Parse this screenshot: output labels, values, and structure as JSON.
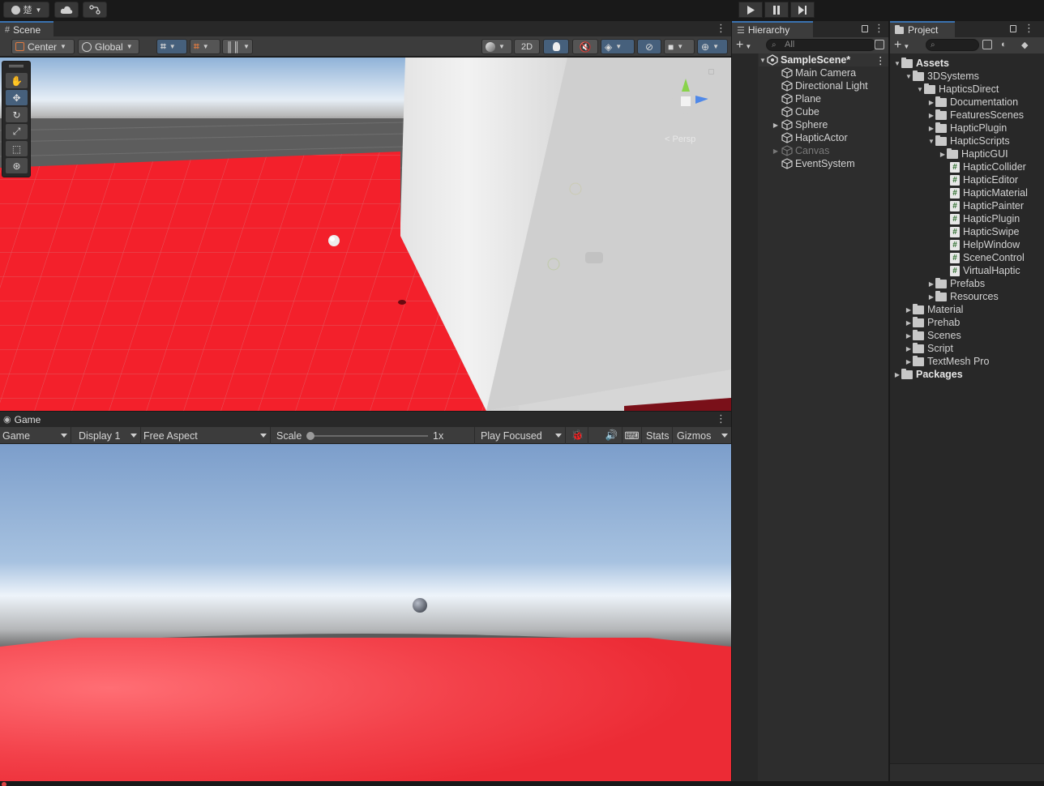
{
  "topbar": {
    "account_label": "楚",
    "play_controls": [
      "play",
      "pause",
      "step"
    ]
  },
  "scene": {
    "tab_label": "Scene",
    "pivot_label": "Center",
    "space_label": "Global",
    "mode_2d_label": "2D",
    "gizmo_axis_y": "y",
    "gizmo_axis_z": "z",
    "gizmo_persp_label": "Persp"
  },
  "game": {
    "tab_label": "Game",
    "view_select": "Game",
    "display_select": "Display 1",
    "aspect_select": "Free Aspect",
    "scale_label": "Scale",
    "scale_value": "1x",
    "play_mode_select": "Play Focused",
    "stats_label": "Stats",
    "gizmos_label": "Gizmos"
  },
  "hierarchy": {
    "tab_label": "Hierarchy",
    "search_placeholder": "All",
    "scene_name": "SampleScene*",
    "items": [
      {
        "label": "Main Camera"
      },
      {
        "label": "Directional Light"
      },
      {
        "label": "Plane"
      },
      {
        "label": "Cube"
      },
      {
        "label": "Sphere"
      },
      {
        "label": "HapticActor"
      },
      {
        "label": "Canvas"
      },
      {
        "label": "EventSystem"
      }
    ]
  },
  "project": {
    "tab_label": "Project",
    "tree": [
      {
        "label": "Assets"
      },
      {
        "label": "3DSystems"
      },
      {
        "label": "HapticsDirect"
      },
      {
        "label": "Documentation"
      },
      {
        "label": "FeaturesScenes"
      },
      {
        "label": "HapticPlugin"
      },
      {
        "label": "HapticScripts"
      },
      {
        "label": "HapticGUI"
      },
      {
        "label": "HapticCollider"
      },
      {
        "label": "HapticEditor"
      },
      {
        "label": "HapticMaterial"
      },
      {
        "label": "HapticPainter"
      },
      {
        "label": "HapticPlugin"
      },
      {
        "label": "HapticSwipe"
      },
      {
        "label": "HelpWindow"
      },
      {
        "label": "SceneControl"
      },
      {
        "label": "VirtualHaptic"
      },
      {
        "label": "Prefabs"
      },
      {
        "label": "Resources"
      },
      {
        "label": "Material"
      },
      {
        "label": "Prehab"
      },
      {
        "label": "Scenes"
      },
      {
        "label": "Script"
      },
      {
        "label": "TextMesh Pro"
      },
      {
        "label": "Packages"
      }
    ]
  },
  "colors": {
    "accent": "#3a72b0",
    "panel": "#282828",
    "plane_red": "#f0202a"
  }
}
